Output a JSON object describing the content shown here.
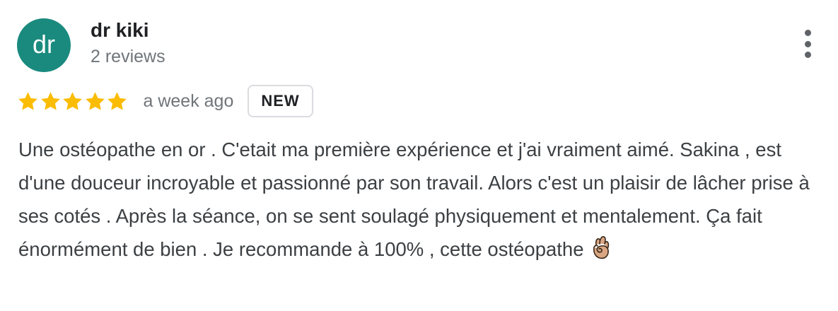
{
  "reviewer": {
    "initials": "dr",
    "name": "dr kiki",
    "meta": "2 reviews",
    "avatar_color": "#1a8a7e"
  },
  "rating": {
    "stars": 5,
    "max": 5,
    "star_color": "#fbbc04",
    "date": "a week ago",
    "badge": "NEW"
  },
  "review": {
    "text": "Une ostéopathe en or . C'etait ma première expérience et j'ai vraiment aimé. Sakina , est d'une douceur incroyable et passionné par son travail. Alors c'est un plaisir de lâcher prise à ses cotés . Après la séance, on se sent soulagé physiquement et mentalement. Ça fait énormément de bien . Je recommande à 100% , cette ostéopathe ",
    "emoji": "ok-hand"
  },
  "menu": {
    "icon": "more-vert-icon"
  }
}
